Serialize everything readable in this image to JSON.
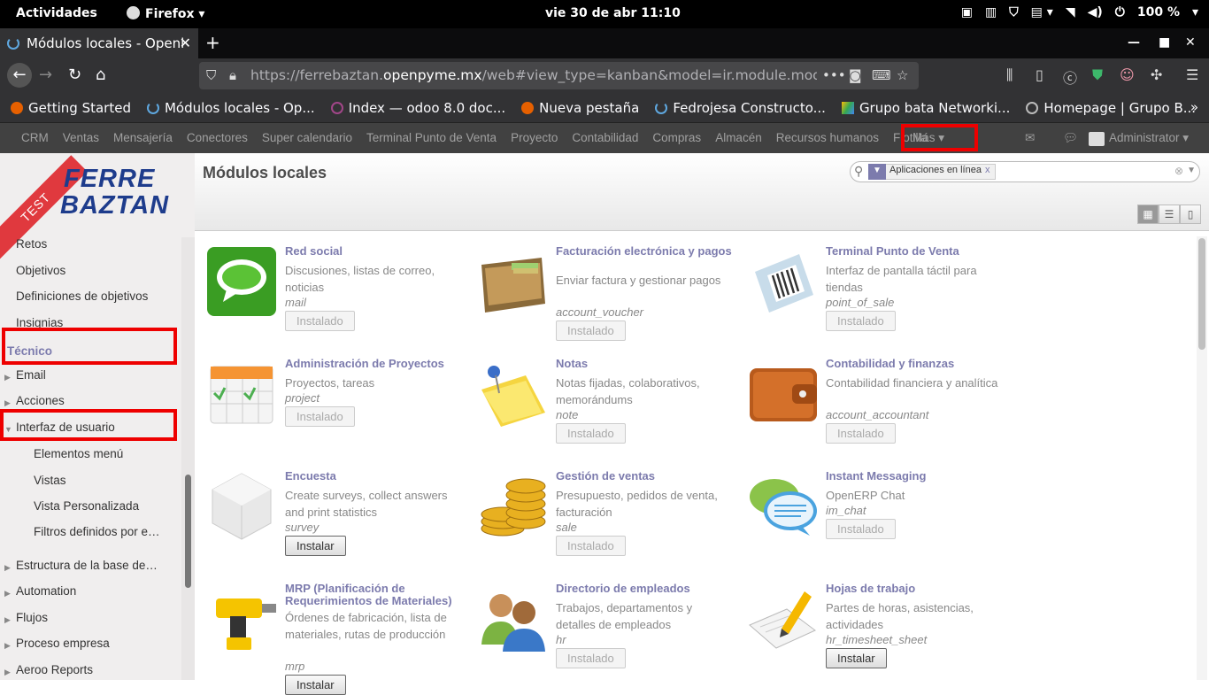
{
  "gnome": {
    "activities": "Actividades",
    "app": "Firefox",
    "clock": "vie 30 de abr  11:10",
    "battery": "100 %"
  },
  "browser": {
    "tab_title": "Módulos locales - Openi",
    "url_gray_prefix": "https://ferrebaztan.",
    "url_domain": "openpyme.mx",
    "url_path": "/web#view_type=kanban&model=ir.module.module&m",
    "bookmarks": [
      {
        "label": "Getting Started",
        "color": "#e66000"
      },
      {
        "label": "Módulos locales - Op...",
        "color": "#5fa8e0"
      },
      {
        "label": "Index — odoo 8.0 doc...",
        "color": "#a24689"
      },
      {
        "label": "Nueva pestaña",
        "color": "#e66000"
      },
      {
        "label": "Fedrojesa Constructo...",
        "color": "#5fa8e0"
      },
      {
        "label": "Grupo bata Networki...",
        "color": "#34a853"
      },
      {
        "label": "Homepage | Grupo B...",
        "color": "#bbbbbb"
      }
    ]
  },
  "odoo": {
    "menu": [
      "CRM",
      "Ventas",
      "Mensajería",
      "Conectores",
      "Super calendario",
      "Terminal Punto de Venta",
      "Proyecto",
      "Contabilidad",
      "Compras",
      "Almacén",
      "Recursos humanos",
      "Flotilla"
    ],
    "more": "Más",
    "user": "Administrator",
    "logo_line1": "FERRE",
    "logo_line2": "BAZTAN",
    "ribbon": "TEST",
    "sidebar": {
      "items_top": [
        "Retos",
        "Objetivos",
        "Definiciones de objetivos",
        "Insignias"
      ],
      "section": "Técnico",
      "email": "Email",
      "acciones": "Acciones",
      "interfaz": "Interfaz de usuario",
      "sub": [
        "Elementos menú",
        "Vistas",
        "Vista Personalizada",
        "Filtros definidos por e…"
      ],
      "bottom": [
        "Estructura de la base de…",
        "Automation",
        "Flujos",
        "Proceso empresa",
        "Aeroo Reports"
      ]
    },
    "page_title": "Módulos locales",
    "facet": "Aplicaciones en línea",
    "modules": [
      {
        "name": "Red social",
        "desc": "Discusiones, listas de correo, noticias",
        "tech": "mail",
        "btn": "Instalado",
        "installed": true,
        "icon": "chat-bubble-icon"
      },
      {
        "name": "Facturación electrónica y pagos",
        "desc": "Enviar factura y gestionar pagos",
        "tech": "account_voucher",
        "btn": "Instalado",
        "installed": true,
        "icon": "wallet-icon"
      },
      {
        "name": "Terminal Punto de Venta",
        "desc": "Interfaz de pantalla táctil para tiendas",
        "tech": "point_of_sale",
        "btn": "Instalado",
        "installed": true,
        "icon": "barcode-icon"
      },
      {
        "name": "Administración de Proyectos",
        "desc": "Proyectos, tareas",
        "tech": "project",
        "btn": "Instalado",
        "installed": true,
        "icon": "calendar-icon"
      },
      {
        "name": "Notas",
        "desc": "Notas fijadas, colaborativos, memorándums",
        "tech": "note",
        "btn": "Instalado",
        "installed": true,
        "icon": "sticky-note-icon"
      },
      {
        "name": "Contabilidad y finanzas",
        "desc": "Contabilidad financiera y analítica",
        "tech": "account_accountant",
        "btn": "Instalado",
        "installed": true,
        "icon": "brown-wallet-icon"
      },
      {
        "name": "Encuesta",
        "desc": "Create surveys, collect answers and print statistics",
        "tech": "survey",
        "btn": "Instalar",
        "installed": false,
        "icon": "cube-icon"
      },
      {
        "name": "Gestión de ventas",
        "desc": "Presupuesto, pedidos de venta, facturación",
        "tech": "sale",
        "btn": "Instalado",
        "installed": true,
        "icon": "coins-icon"
      },
      {
        "name": "Instant Messaging",
        "desc": "OpenERP Chat",
        "tech": "im_chat",
        "btn": "Instalado",
        "installed": true,
        "icon": "speech-bubbles-icon"
      },
      {
        "name": "MRP (Planificación de Requerimientos de Materiales)",
        "desc": "Órdenes de fabricación, lista de materiales, rutas de producción",
        "tech": "mrp",
        "btn": "Instalar",
        "installed": false,
        "icon": "drill-icon"
      },
      {
        "name": "Directorio de empleados",
        "desc": "Trabajos, departamentos y detalles de empleados",
        "tech": "hr",
        "btn": "Instalado",
        "installed": true,
        "icon": "people-icon"
      },
      {
        "name": "Hojas de trabajo",
        "desc": "Partes de horas, asistencias, actividades",
        "tech": "hr_timesheet_sheet",
        "btn": "Instalar",
        "installed": false,
        "icon": "pen-paper-icon"
      }
    ]
  }
}
